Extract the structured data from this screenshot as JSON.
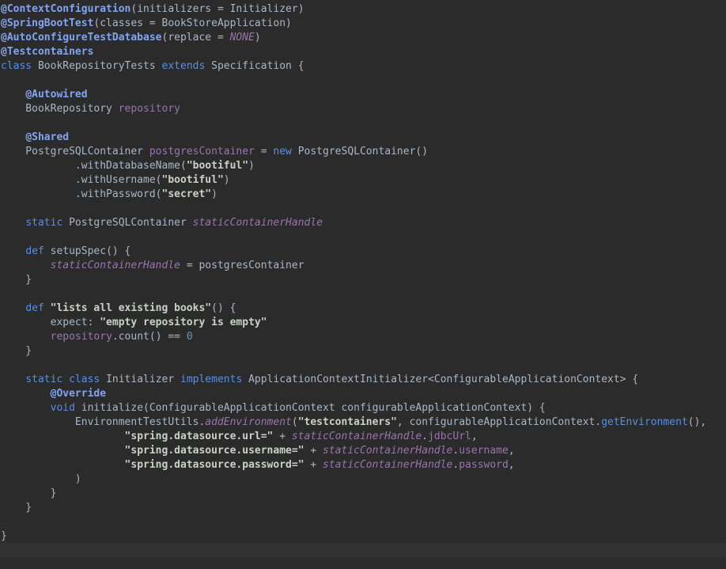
{
  "editor": {
    "lines": [
      [
        {
          "t": "@ContextConfiguration",
          "c": "ann"
        },
        {
          "t": "(initializers = Initializer)",
          "c": "plain"
        }
      ],
      [
        {
          "t": "@SpringBootTest",
          "c": "ann"
        },
        {
          "t": "(classes = BookStoreApplication)",
          "c": "plain"
        }
      ],
      [
        {
          "t": "@AutoConfigureTestDatabase",
          "c": "ann"
        },
        {
          "t": "(replace = ",
          "c": "plain"
        },
        {
          "t": "NONE",
          "c": "const"
        },
        {
          "t": ")",
          "c": "plain"
        }
      ],
      [
        {
          "t": "@Testcontainers",
          "c": "ann"
        }
      ],
      [
        {
          "t": "class",
          "c": "kw"
        },
        {
          "t": " BookRepositoryTests ",
          "c": "plain"
        },
        {
          "t": "extends",
          "c": "kw"
        },
        {
          "t": " Specification {",
          "c": "plain"
        }
      ],
      [],
      [
        {
          "t": "    ",
          "c": "plain"
        },
        {
          "t": "@Autowired",
          "c": "ann"
        }
      ],
      [
        {
          "t": "    BookRepository ",
          "c": "plain"
        },
        {
          "t": "repository",
          "c": "field"
        }
      ],
      [],
      [
        {
          "t": "    ",
          "c": "plain"
        },
        {
          "t": "@Shared",
          "c": "ann"
        }
      ],
      [
        {
          "t": "    PostgreSQLContainer ",
          "c": "plain"
        },
        {
          "t": "postgresContainer",
          "c": "field"
        },
        {
          "t": " = ",
          "c": "plain"
        },
        {
          "t": "new",
          "c": "kw"
        },
        {
          "t": " PostgreSQLContainer()",
          "c": "plain"
        }
      ],
      [
        {
          "t": "            .withDatabaseName(",
          "c": "plain"
        },
        {
          "t": "\"bootiful\"",
          "c": "str"
        },
        {
          "t": ")",
          "c": "plain"
        }
      ],
      [
        {
          "t": "            .withUsername(",
          "c": "plain"
        },
        {
          "t": "\"bootiful\"",
          "c": "str"
        },
        {
          "t": ")",
          "c": "plain"
        }
      ],
      [
        {
          "t": "            .withPassword(",
          "c": "plain"
        },
        {
          "t": "\"secret\"",
          "c": "str"
        },
        {
          "t": ")",
          "c": "plain"
        }
      ],
      [],
      [
        {
          "t": "    ",
          "c": "plain"
        },
        {
          "t": "static",
          "c": "kw"
        },
        {
          "t": " PostgreSQLContainer ",
          "c": "plain"
        },
        {
          "t": "staticContainerHandle",
          "c": "static"
        }
      ],
      [],
      [
        {
          "t": "    ",
          "c": "plain"
        },
        {
          "t": "def",
          "c": "kw"
        },
        {
          "t": " setupSpec() {",
          "c": "plain"
        }
      ],
      [
        {
          "t": "        ",
          "c": "plain"
        },
        {
          "t": "staticContainerHandle",
          "c": "static"
        },
        {
          "t": " = postgresContainer",
          "c": "plain"
        }
      ],
      [
        {
          "t": "    }",
          "c": "plain"
        }
      ],
      [],
      [
        {
          "t": "    ",
          "c": "plain"
        },
        {
          "t": "def",
          "c": "kw"
        },
        {
          "t": " ",
          "c": "plain"
        },
        {
          "t": "\"lists all existing books\"",
          "c": "str"
        },
        {
          "t": "() {",
          "c": "plain"
        }
      ],
      [
        {
          "t": "        expect: ",
          "c": "plain"
        },
        {
          "t": "\"empty repository is empty\"",
          "c": "str"
        }
      ],
      [
        {
          "t": "        ",
          "c": "plain"
        },
        {
          "t": "repository",
          "c": "field"
        },
        {
          "t": ".count() == ",
          "c": "plain"
        },
        {
          "t": "0",
          "c": "num"
        }
      ],
      [
        {
          "t": "    }",
          "c": "plain"
        }
      ],
      [],
      [
        {
          "t": "    ",
          "c": "plain"
        },
        {
          "t": "static",
          "c": "kw"
        },
        {
          "t": " ",
          "c": "plain"
        },
        {
          "t": "class",
          "c": "kw"
        },
        {
          "t": " Initializer ",
          "c": "plain"
        },
        {
          "t": "implements",
          "c": "kw"
        },
        {
          "t": " ApplicationContextInitializer<ConfigurableApplicationContext> {",
          "c": "plain"
        }
      ],
      [
        {
          "t": "        ",
          "c": "plain"
        },
        {
          "t": "@Override",
          "c": "ann"
        }
      ],
      [
        {
          "t": "        ",
          "c": "plain"
        },
        {
          "t": "void",
          "c": "kw"
        },
        {
          "t": " initialize(ConfigurableApplicationContext configurableApplicationContext) {",
          "c": "plain"
        }
      ],
      [
        {
          "t": "            EnvironmentTestUtils.",
          "c": "plain"
        },
        {
          "t": "addEnvironment",
          "c": "static"
        },
        {
          "t": "(",
          "c": "plain"
        },
        {
          "t": "\"testcontainers\"",
          "c": "str"
        },
        {
          "t": ", configurableApplicationContext.",
          "c": "plain"
        },
        {
          "t": "getEnvironment",
          "c": "kwm"
        },
        {
          "t": "(),",
          "c": "plain"
        }
      ],
      [
        {
          "t": "                    ",
          "c": "plain"
        },
        {
          "t": "\"spring.datasource.url=\"",
          "c": "str"
        },
        {
          "t": " + ",
          "c": "plain"
        },
        {
          "t": "staticContainerHandle",
          "c": "static"
        },
        {
          "t": ".",
          "c": "plain"
        },
        {
          "t": "jdbcUrl",
          "c": "field"
        },
        {
          "t": ",",
          "c": "plain"
        }
      ],
      [
        {
          "t": "                    ",
          "c": "plain"
        },
        {
          "t": "\"spring.datasource.username=\"",
          "c": "str"
        },
        {
          "t": " + ",
          "c": "plain"
        },
        {
          "t": "staticContainerHandle",
          "c": "static"
        },
        {
          "t": ".",
          "c": "plain"
        },
        {
          "t": "username",
          "c": "field"
        },
        {
          "t": ",",
          "c": "plain"
        }
      ],
      [
        {
          "t": "                    ",
          "c": "plain"
        },
        {
          "t": "\"spring.datasource.password=\"",
          "c": "str"
        },
        {
          "t": " + ",
          "c": "plain"
        },
        {
          "t": "staticContainerHandle",
          "c": "static"
        },
        {
          "t": ".",
          "c": "plain"
        },
        {
          "t": "password",
          "c": "field"
        },
        {
          "t": ",",
          "c": "plain"
        }
      ],
      [
        {
          "t": "            )",
          "c": "plain"
        }
      ],
      [
        {
          "t": "        }",
          "c": "plain"
        }
      ],
      [
        {
          "t": "    }",
          "c": "plain"
        }
      ],
      [],
      [
        {
          "t": "}",
          "c": "plain"
        }
      ]
    ]
  },
  "colors": {
    "background": "#2b2b2b",
    "current_line": "#323232",
    "annotation": "#83a4f1",
    "keyword": "#5a8fe0",
    "string": "#c9d2c6",
    "field": "#9876aa",
    "number": "#6897bb",
    "plain": "#a9b7c6"
  }
}
